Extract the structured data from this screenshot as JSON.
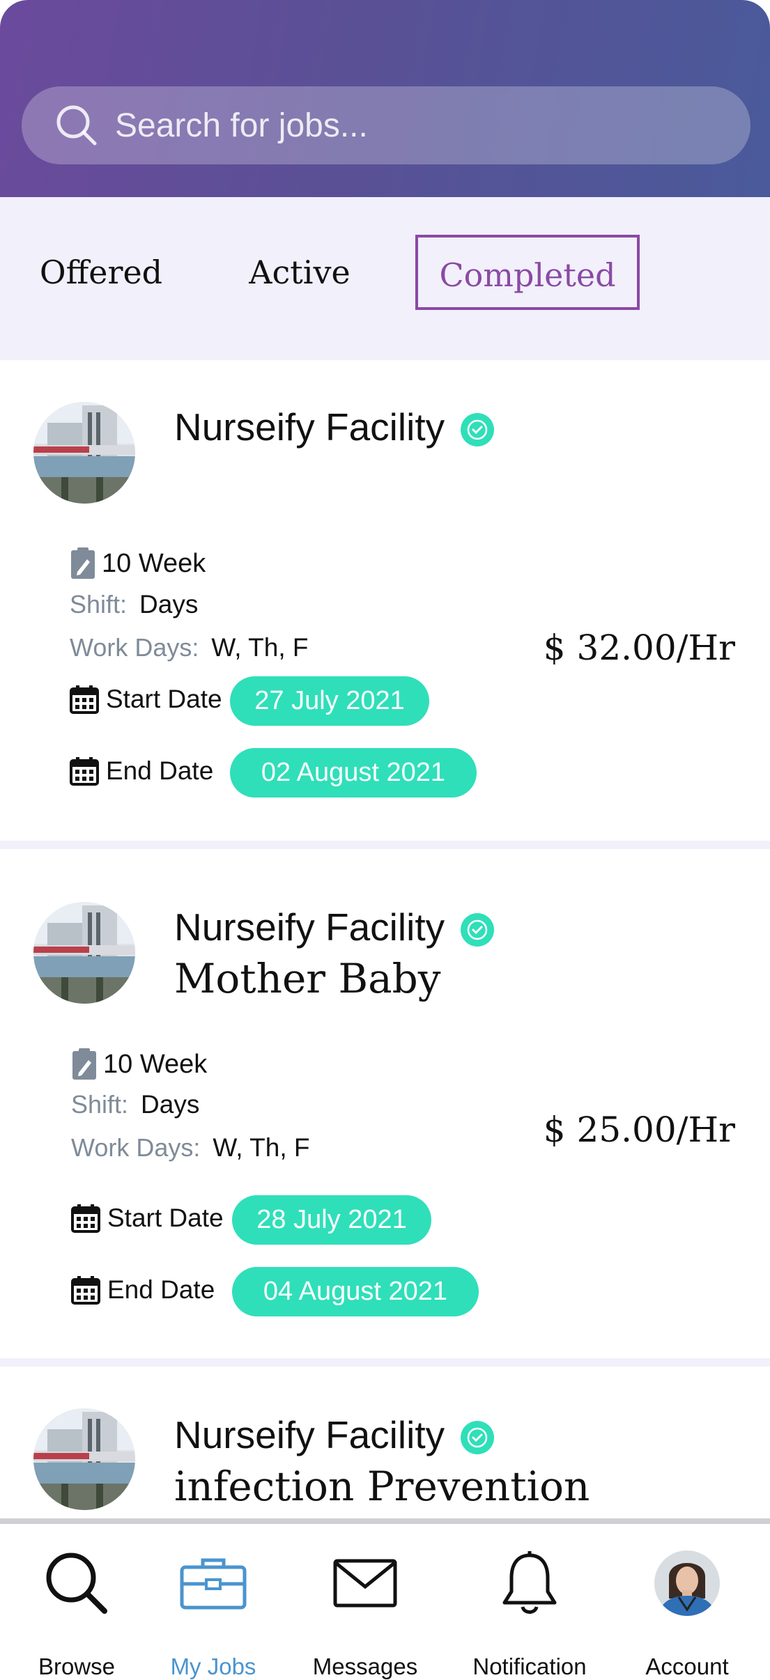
{
  "search": {
    "placeholder": "Search for jobs..."
  },
  "tabs": [
    {
      "label": "Offered",
      "selected": false
    },
    {
      "label": "Active",
      "selected": false
    },
    {
      "label": "Completed",
      "selected": true
    }
  ],
  "jobs": [
    {
      "facility": "Nurseify Facility",
      "verified": true,
      "subtitle": "",
      "duration": "10 Week",
      "shift_label": "Shift:",
      "shift": "Days",
      "workdays_label": "Work Days:",
      "workdays": "W, Th, F",
      "start_label": "Start Date",
      "start_date": "27 July 2021",
      "end_label": "End Date",
      "end_date": "02 August 2021",
      "rate": "$ 32.00/Hr"
    },
    {
      "facility": "Nurseify Facility",
      "verified": true,
      "subtitle": "Mother Baby",
      "duration": "10 Week",
      "shift_label": "Shift:",
      "shift": "Days",
      "workdays_label": "Work Days:",
      "workdays": "W, Th, F",
      "start_label": "Start Date",
      "start_date": "28 July 2021",
      "end_label": "End Date",
      "end_date": "04 August 2021",
      "rate": "$ 25.00/Hr"
    },
    {
      "facility": "Nurseify Facility",
      "verified": true,
      "subtitle": "infection Prevention"
    }
  ],
  "nav": [
    {
      "label": "Browse",
      "icon": "search-icon",
      "active": false
    },
    {
      "label": "My Jobs",
      "icon": "briefcase-icon",
      "active": true
    },
    {
      "label": "Messages",
      "icon": "mail-icon",
      "active": false
    },
    {
      "label": "Notification",
      "icon": "bell-icon",
      "active": false
    },
    {
      "label": "Account",
      "icon": "user-avatar",
      "active": false
    }
  ],
  "colors": {
    "accent": "#8a4aa5",
    "pill": "#2fdfb9",
    "nav_active": "#4a94cf",
    "tab_bg": "#f2f0fa"
  }
}
